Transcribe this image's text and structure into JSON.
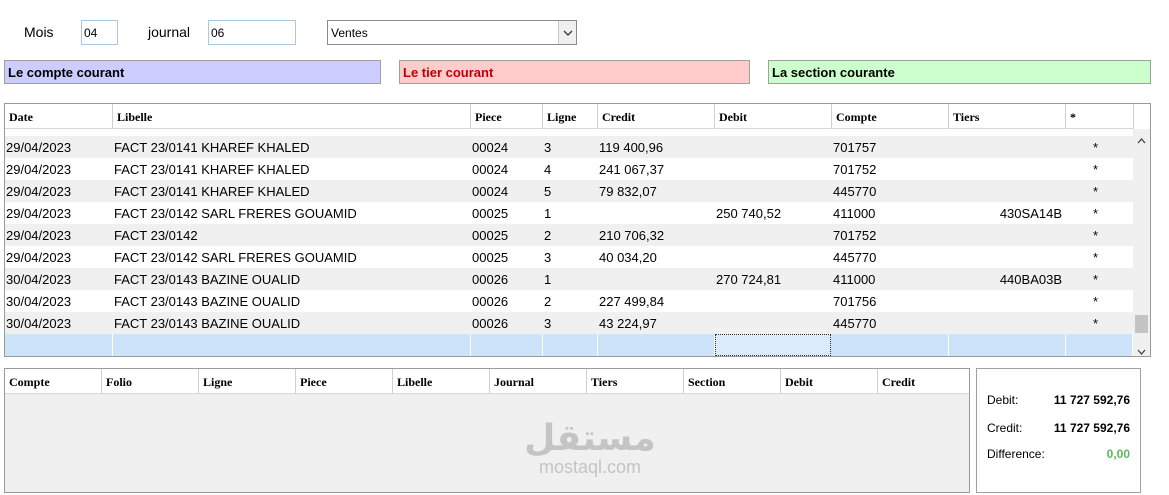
{
  "filters": {
    "mois_label": "Mois",
    "mois_value": "04",
    "journal_label": "journal",
    "journal_value": "06",
    "type_value": "Ventes"
  },
  "banners": {
    "compte": "Le compte courant",
    "tier": "Le tier courant",
    "section": "La section courante"
  },
  "colors": {
    "compte_bg": "#ccccff",
    "tier_bg": "#ffcccc",
    "section_bg": "#ccffcc",
    "selection_row": "#cde3fa",
    "difference_value": "#5cb85c"
  },
  "main_grid": {
    "columns": [
      "Date",
      "Libelle",
      "Piece",
      "Ligne",
      "Credit",
      "Debit",
      "Compte",
      "Tiers",
      "*"
    ],
    "rows": [
      [
        "29/04/2023",
        "FACT 23/0141 KHAREF KHALED",
        "00024",
        "3",
        "119 400,96",
        "",
        "701757",
        "",
        "*"
      ],
      [
        "29/04/2023",
        "FACT 23/0141 KHAREF KHALED",
        "00024",
        "4",
        "241 067,37",
        "",
        "701752",
        "",
        "*"
      ],
      [
        "29/04/2023",
        "FACT 23/0141 KHAREF KHALED",
        "00024",
        "5",
        "79 832,07",
        "",
        "445770",
        "",
        "*"
      ],
      [
        "29/04/2023",
        "FACT 23/0142 SARL FRERES GOUAMID",
        "00025",
        "1",
        "",
        "250 740,52",
        "411000",
        "430SA14B",
        "*"
      ],
      [
        "29/04/2023",
        "FACT 23/0142",
        "00025",
        "2",
        "210 706,32",
        "",
        "701752",
        "",
        "*"
      ],
      [
        "29/04/2023",
        "FACT 23/0142 SARL FRERES GOUAMID",
        "00025",
        "3",
        "40 034,20",
        "",
        "445770",
        "",
        "*"
      ],
      [
        "30/04/2023",
        "FACT 23/0143 BAZINE OUALID",
        "00026",
        "1",
        "",
        "270 724,81",
        "411000",
        "440BA03B",
        "*"
      ],
      [
        "30/04/2023",
        "FACT 23/0143 BAZINE OUALID",
        "00026",
        "2",
        "227 499,84",
        "",
        "701756",
        "",
        "*"
      ],
      [
        "30/04/2023",
        "FACT 23/0143 BAZINE OUALID",
        "00026",
        "3",
        "43 224,97",
        "",
        "445770",
        "",
        "*"
      ]
    ]
  },
  "detail_grid": {
    "columns": [
      "Compte",
      "Folio",
      "Ligne",
      "Piece",
      "Libelle",
      "Journal",
      "Tiers",
      "Section",
      "Debit",
      "Credit"
    ]
  },
  "totals": {
    "debit_label": "Debit:",
    "debit_value": "11 727 592,76",
    "credit_label": "Credit:",
    "credit_value": "11 727 592,76",
    "difference_label": "Difference:",
    "difference_value": "0,00"
  },
  "watermark": {
    "arabic": "مستقل",
    "latin": "mostaql.com"
  }
}
